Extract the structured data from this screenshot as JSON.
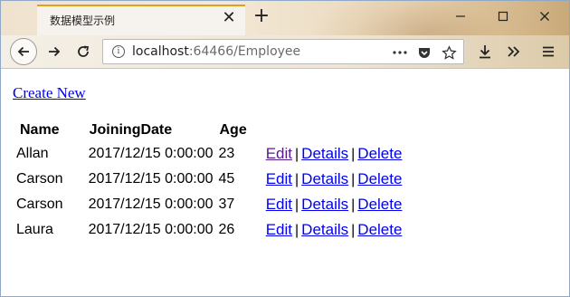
{
  "browser": {
    "tab_title": "数据模型示例",
    "url_host": "localhost",
    "url_path": ":64466/Employee"
  },
  "page": {
    "create_new": "Create New",
    "columns": [
      "Name",
      "JoiningDate",
      "Age"
    ],
    "rows": [
      {
        "name": "Allan",
        "joining_date": "2017/12/15 0:00:00",
        "age": "23",
        "edit": "Edit",
        "details": "Details",
        "delete": "Delete",
        "sep": "|"
      },
      {
        "name": "Carson",
        "joining_date": "2017/12/15 0:00:00",
        "age": "45",
        "edit": "Edit",
        "details": "Details",
        "delete": "Delete",
        "sep": "|"
      },
      {
        "name": "Carson",
        "joining_date": "2017/12/15 0:00:00",
        "age": "37",
        "edit": "Edit",
        "details": "Details",
        "delete": "Delete",
        "sep": "|"
      },
      {
        "name": "Laura",
        "joining_date": "2017/12/15 0:00:00",
        "age": "26",
        "edit": "Edit",
        "details": "Details",
        "delete": "Delete",
        "sep": "|"
      }
    ]
  },
  "colors": {
    "link": "#0000ee",
    "visited_link": "#551a8b",
    "tab_accent": "#e2a11b"
  }
}
